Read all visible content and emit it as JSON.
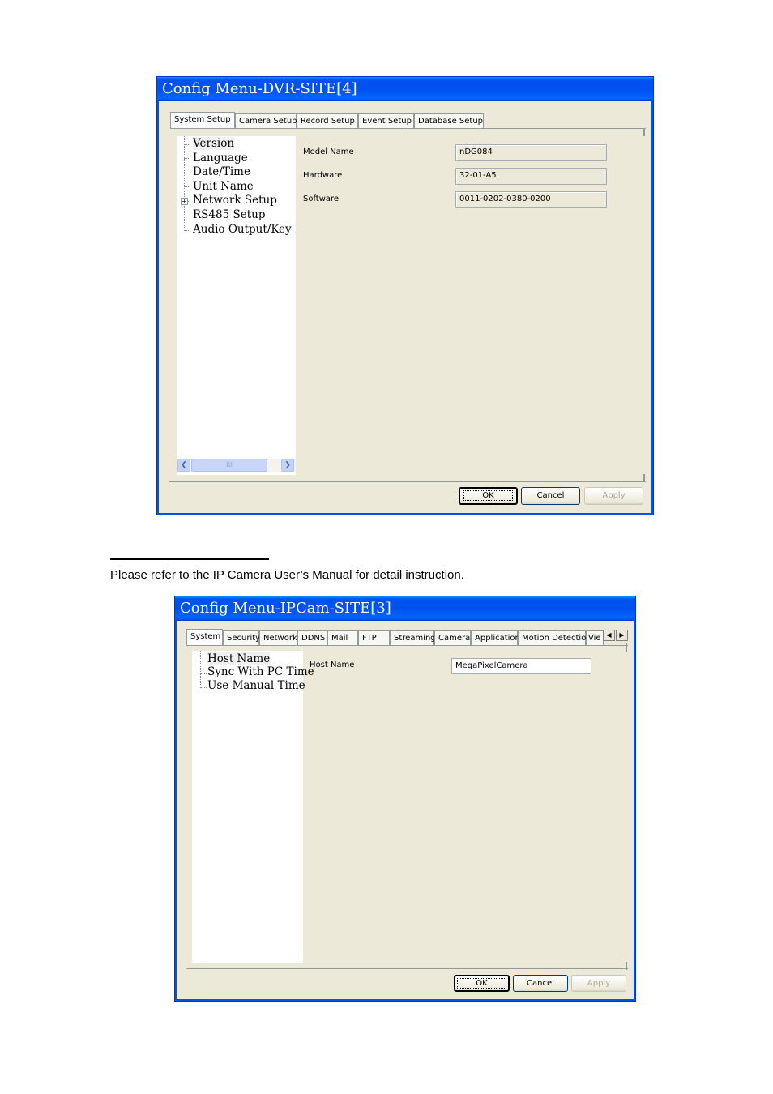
{
  "dvr_window": {
    "title": "Config Menu-DVR-SITE[4]",
    "tabs": [
      "System Setup",
      "Camera Setup",
      "Record Setup",
      "Event Setup",
      "Database Setup"
    ],
    "tree": [
      "Version",
      "Language",
      "Date/Time",
      "Unit Name",
      "Network Setup",
      "RS485 Setup",
      "Audio Output/Key B"
    ],
    "tree_expander": "+",
    "fields": [
      {
        "label": "Model Name",
        "value": "nDG084"
      },
      {
        "label": "Hardware",
        "value": "32-01-A5"
      },
      {
        "label": "Software",
        "value": "0011-0202-0380-0200"
      }
    ],
    "scroll_thumb_grip": "III",
    "buttons": {
      "ok": "OK",
      "cancel": "Cancel",
      "apply": "Apply"
    }
  },
  "footnote": {
    "text": "Please refer to the IP Camera User’s Manual for detail instruction."
  },
  "ipcam_window": {
    "title": "Config Menu-IPCam-SITE[3]",
    "tabs": [
      "System",
      "Security",
      "Network",
      "DDNS",
      "Mail",
      "FTP",
      "Streaming",
      "Camera",
      "Application",
      "Motion Detection",
      "Vie"
    ],
    "tree": [
      "Host Name",
      "Sync With PC Time",
      "Use Manual Time"
    ],
    "fields": [
      {
        "label": "Host Name",
        "value": "MegaPixelCamera"
      }
    ],
    "buttons": {
      "ok": "OK",
      "cancel": "Cancel",
      "apply": "Apply"
    }
  },
  "icons": [
    "scroll-left-arrow",
    "scroll-right-arrow",
    "tab-scroll-left",
    "tab-scroll-right",
    "tree-expand-plus"
  ],
  "colors": {
    "title_blue": "#0053ee",
    "dialog_bg": "#ece9d8"
  }
}
